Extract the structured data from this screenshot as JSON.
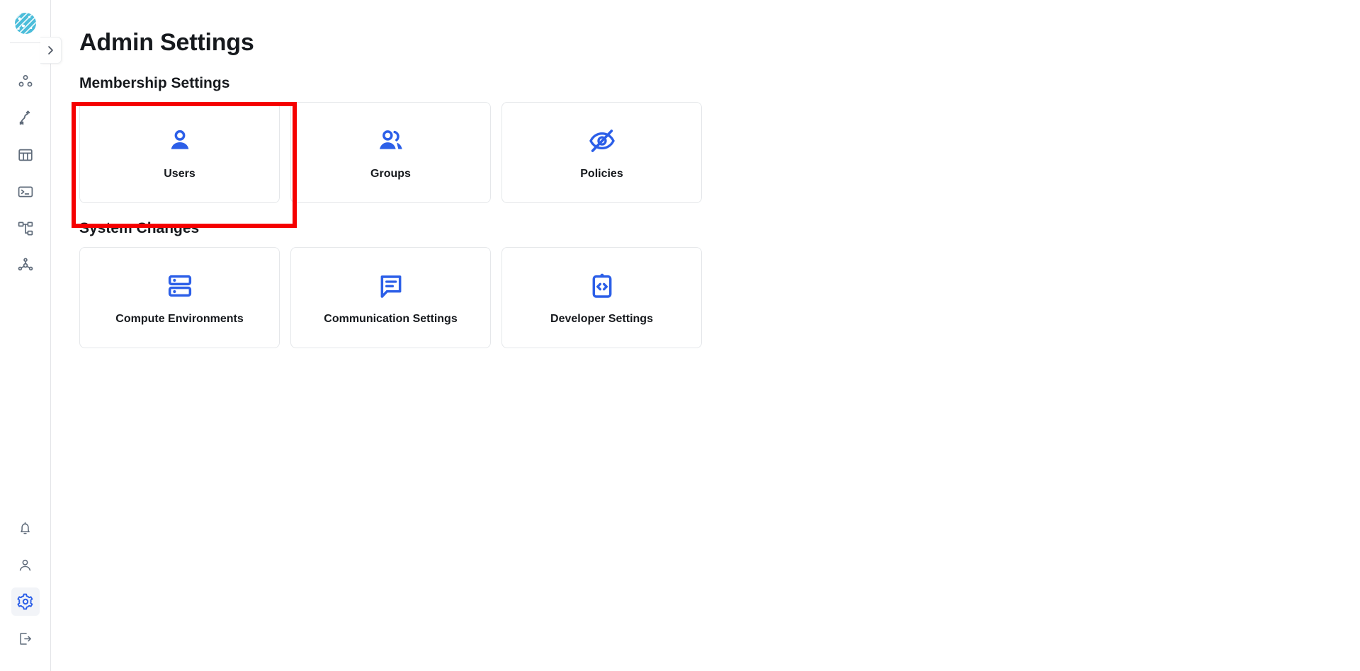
{
  "app": {
    "logo_name": "platform-logo",
    "accent_color": "#2c5fe8",
    "logo_color": "#4BBDDA",
    "highlight_color": "#f50000"
  },
  "sidebar": {
    "collapse_button": {
      "label": "›",
      "icon": "chevron-right-icon"
    },
    "top_items": [
      {
        "icon": "data-nodes-icon",
        "name": "sidebar-item-data-nodes"
      },
      {
        "icon": "pipeline-flow-icon",
        "name": "sidebar-item-pipelines"
      },
      {
        "icon": "table-grid-icon",
        "name": "sidebar-item-tables"
      },
      {
        "icon": "terminal-console-icon",
        "name": "sidebar-item-console"
      },
      {
        "icon": "hierarchy-tree-icon",
        "name": "sidebar-item-hierarchy"
      },
      {
        "icon": "network-hub-icon",
        "name": "sidebar-item-network"
      }
    ],
    "bottom_items": [
      {
        "icon": "bell-icon",
        "name": "sidebar-item-notifications",
        "active": false
      },
      {
        "icon": "person-icon",
        "name": "sidebar-item-profile",
        "active": false
      },
      {
        "icon": "gear-icon",
        "name": "sidebar-item-settings",
        "active": true
      },
      {
        "icon": "logout-icon",
        "name": "sidebar-item-logout",
        "active": false
      }
    ]
  },
  "main": {
    "page_title": "Admin Settings",
    "sections": [
      {
        "title": "Membership Settings",
        "cards": [
          {
            "label": "Users",
            "icon": "single-person-icon"
          },
          {
            "label": "Groups",
            "icon": "people-group-icon"
          },
          {
            "label": "Policies",
            "icon": "eye-off-icon"
          }
        ]
      },
      {
        "title": "System Changes",
        "cards": [
          {
            "label": "Compute Environments",
            "icon": "server-stack-icon"
          },
          {
            "label": "Communication Settings",
            "icon": "chat-bubble-icon"
          },
          {
            "label": "Developer Settings",
            "icon": "clipboard-code-icon"
          }
        ]
      }
    ]
  },
  "highlight": {
    "target": "Users",
    "label": "users-card-highlight"
  }
}
